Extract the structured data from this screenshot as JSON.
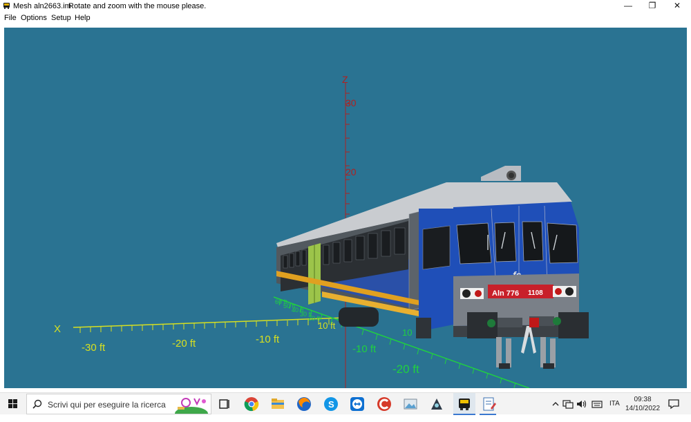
{
  "window": {
    "title": "Mesh aln2663.im",
    "hint": "Rotate and zoom with the mouse please.",
    "minimize_glyph": "—",
    "restore_glyph": "❐",
    "close_glyph": "✕"
  },
  "menu": {
    "items": [
      "File",
      "Options",
      "Setup",
      "Help"
    ]
  },
  "scene": {
    "background": "#2a7392",
    "z_axis": {
      "label": "Z",
      "ticks": [
        "30",
        "20"
      ]
    },
    "x_axis": {
      "label": "X",
      "ticks": [
        "-30 ft",
        "-20 ft",
        "-10 ft"
      ]
    },
    "y_axis": {
      "ticks": [
        "10 ft",
        "-10 ft",
        "-20 ft"
      ]
    },
    "y_axis_near_labels": [
      "10",
      "20 ft",
      "30 ft",
      "40 ft",
      "50 ft",
      "60 ft"
    ],
    "z_axis_low_label": "10",
    "train": {
      "number_left": "Aln 776",
      "number_right": "1108",
      "body_color": "#1f4fb8",
      "stripe_color": "#e0a020",
      "number_band_color": "#c8202a",
      "logo_text": "fs"
    }
  },
  "taskbar": {
    "search_placeholder": "Scrivi qui per eseguire la ricerca",
    "language": "ITA",
    "time": "09:38",
    "date": "14/10/2022",
    "pinned_icons": [
      "task-view-icon",
      "chrome-icon",
      "file-explorer-icon",
      "firefox-icon",
      "skype-icon",
      "teamviewer-icon",
      "ccleaner-icon",
      "photos-icon",
      "network-app-icon",
      "train-app-icon",
      "editor-app-icon"
    ]
  }
}
